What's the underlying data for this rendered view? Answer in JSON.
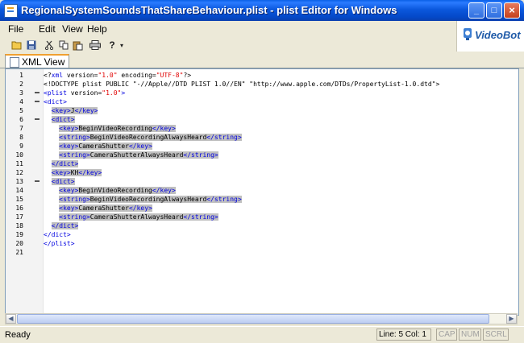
{
  "window": {
    "title": "RegionalSystemSoundsThatShareBehaviour.plist - plist Editor for Windows",
    "minimize": "_",
    "maximize": "□",
    "close": "×"
  },
  "menu": [
    "File",
    "Edit",
    "View",
    "Help"
  ],
  "logo": {
    "text": "VideoBot"
  },
  "tab": {
    "label": "XML View"
  },
  "editor": {
    "lines": [
      {
        "n": "1",
        "parts": [
          {
            "t": "<?",
            "c": "t-pi"
          },
          {
            "t": "xml",
            "c": "t-tag"
          },
          {
            "t": " version=",
            "c": "t-text"
          },
          {
            "t": "\"1.0\"",
            "c": "t-val"
          },
          {
            "t": " encoding=",
            "c": "t-text"
          },
          {
            "t": "\"UTF-8\"",
            "c": "t-val"
          },
          {
            "t": "?>",
            "c": "t-pi"
          }
        ]
      },
      {
        "n": "2",
        "parts": [
          {
            "t": "<!DOCTYPE plist PUBLIC \"-//Apple//DTD PLIST 1.0//EN\" \"http://www.apple.com/DTDs/PropertyList-1.0.dtd\">",
            "c": "t-text"
          }
        ]
      },
      {
        "n": "3",
        "fold": true,
        "parts": [
          {
            "t": "<plist",
            "c": "t-tag"
          },
          {
            "t": " version=",
            "c": "t-text"
          },
          {
            "t": "\"1.0\"",
            "c": "t-val"
          },
          {
            "t": ">",
            "c": "t-tag"
          }
        ]
      },
      {
        "n": "4",
        "fold": true,
        "parts": [
          {
            "t": "<dict>",
            "c": "t-tag"
          }
        ]
      },
      {
        "n": "5",
        "sel": true,
        "indent": "  ",
        "parts": [
          {
            "t": "<key>",
            "c": "t-tag"
          },
          {
            "t": "J",
            "c": "t-text"
          },
          {
            "t": "</key>",
            "c": "t-tag"
          }
        ]
      },
      {
        "n": "6",
        "fold": true,
        "sel": true,
        "indent": "  ",
        "parts": [
          {
            "t": "<dict>",
            "c": "t-tag"
          }
        ]
      },
      {
        "n": "7",
        "sel": true,
        "indent": "    ",
        "parts": [
          {
            "t": "<key>",
            "c": "t-tag"
          },
          {
            "t": "BeginVideoRecording",
            "c": "t-text"
          },
          {
            "t": "</key>",
            "c": "t-tag"
          }
        ]
      },
      {
        "n": "8",
        "sel": true,
        "indent": "    ",
        "parts": [
          {
            "t": "<string>",
            "c": "t-tag"
          },
          {
            "t": "BeginVideoRecordingAlwaysHeard",
            "c": "t-text"
          },
          {
            "t": "</string>",
            "c": "t-tag"
          }
        ]
      },
      {
        "n": "9",
        "sel": true,
        "indent": "    ",
        "parts": [
          {
            "t": "<key>",
            "c": "t-tag"
          },
          {
            "t": "CameraShutter",
            "c": "t-text"
          },
          {
            "t": "</key>",
            "c": "t-tag"
          }
        ]
      },
      {
        "n": "10",
        "sel": true,
        "indent": "    ",
        "parts": [
          {
            "t": "<string>",
            "c": "t-tag"
          },
          {
            "t": "CameraShutterAlwaysHeard",
            "c": "t-text"
          },
          {
            "t": "</string>",
            "c": "t-tag"
          }
        ]
      },
      {
        "n": "11",
        "sel": true,
        "indent": "  ",
        "parts": [
          {
            "t": "</dict>",
            "c": "t-tag"
          }
        ]
      },
      {
        "n": "12",
        "sel": true,
        "indent": "  ",
        "parts": [
          {
            "t": "<key>",
            "c": "t-tag"
          },
          {
            "t": "KH",
            "c": "t-text"
          },
          {
            "t": "</key>",
            "c": "t-tag"
          }
        ]
      },
      {
        "n": "13",
        "fold": true,
        "sel": true,
        "indent": "  ",
        "parts": [
          {
            "t": "<dict>",
            "c": "t-tag"
          }
        ]
      },
      {
        "n": "14",
        "sel": true,
        "indent": "    ",
        "parts": [
          {
            "t": "<key>",
            "c": "t-tag"
          },
          {
            "t": "BeginVideoRecording",
            "c": "t-text"
          },
          {
            "t": "</key>",
            "c": "t-tag"
          }
        ]
      },
      {
        "n": "15",
        "sel": true,
        "indent": "    ",
        "parts": [
          {
            "t": "<string>",
            "c": "t-tag"
          },
          {
            "t": "BeginVideoRecordingAlwaysHeard",
            "c": "t-text"
          },
          {
            "t": "</string>",
            "c": "t-tag"
          }
        ]
      },
      {
        "n": "16",
        "sel": true,
        "indent": "    ",
        "parts": [
          {
            "t": "<key>",
            "c": "t-tag"
          },
          {
            "t": "CameraShutter",
            "c": "t-text"
          },
          {
            "t": "</key>",
            "c": "t-tag"
          }
        ]
      },
      {
        "n": "17",
        "sel": true,
        "indent": "    ",
        "parts": [
          {
            "t": "<string>",
            "c": "t-tag"
          },
          {
            "t": "CameraShutterAlwaysHeard",
            "c": "t-text"
          },
          {
            "t": "</string>",
            "c": "t-tag"
          }
        ]
      },
      {
        "n": "18",
        "sel": true,
        "indent": "  ",
        "parts": [
          {
            "t": "</dict>",
            "c": "t-tag"
          }
        ]
      },
      {
        "n": "19",
        "parts": [
          {
            "t": "</dict>",
            "c": "t-tag"
          }
        ]
      },
      {
        "n": "20",
        "parts": [
          {
            "t": "</plist>",
            "c": "t-tag"
          }
        ]
      },
      {
        "n": "21",
        "parts": []
      }
    ]
  },
  "status": {
    "ready": "Ready",
    "position": "Line: 5 Col: 1",
    "cap": "CAP",
    "num": "NUM",
    "scrl": "SCRL"
  }
}
